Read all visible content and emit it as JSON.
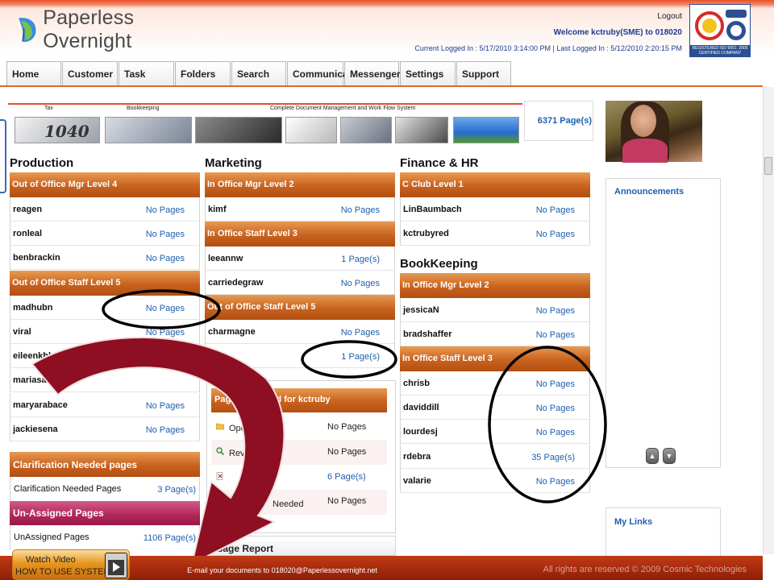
{
  "header": {
    "logo_text": "Paperless Overnight",
    "logout": "Logout",
    "welcome": "Welcome kctruby(SME) to 018020",
    "login_info": "Current Logged In : 5/17/2010 3:14:00 PM  |  Last Logged In : 5/12/2010 2:20:15 PM",
    "cert_text": "REGISTERED ISO 9001: 2000 CERTIFIED COMPANY"
  },
  "nav": [
    {
      "label": "Home"
    },
    {
      "label": "Customer"
    },
    {
      "label": "Task"
    },
    {
      "label": "Folders"
    },
    {
      "label": "Search"
    },
    {
      "label": "Communicate"
    },
    {
      "label": "Messenger"
    },
    {
      "label": "Settings"
    },
    {
      "label": "Support"
    }
  ],
  "banner": {
    "labels": [
      "Tax",
      "Bookkeeping",
      "Complete Document Management and Work Flow System"
    ],
    "total_pages": "6371 Page(s)"
  },
  "production": {
    "title": "Production",
    "group1_title": "Out of Office Mgr Level 4",
    "group1": [
      {
        "name": "reagen",
        "value": "No Pages"
      },
      {
        "name": "ronleal",
        "value": "No Pages"
      },
      {
        "name": "benbrackin",
        "value": "No Pages"
      }
    ],
    "group2_title": "Out of Office Staff Level 5",
    "group2": [
      {
        "name": "madhubn",
        "value": "No Pages"
      },
      {
        "name": "viral",
        "value": "No Pages"
      },
      {
        "name": "eileenkhlair",
        "value": ""
      },
      {
        "name": "mariasantiago",
        "value": ""
      },
      {
        "name": "maryarabace",
        "value": "No Pages"
      },
      {
        "name": "jackiesena",
        "value": "No Pages"
      }
    ]
  },
  "marketing": {
    "title": "Marketing",
    "group1_title": "In Office Mgr Level 2",
    "group1": [
      {
        "name": "kimf",
        "value": "No Pages"
      }
    ],
    "group2_title": "In Office Staff Level 3",
    "group2": [
      {
        "name": "leeannw",
        "value": "1 Page(s)"
      },
      {
        "name": "carriedegraw",
        "value": "No Pages"
      }
    ],
    "group3_title": "Out of Office Staff Level 5",
    "group3": [
      {
        "name": "charmagne",
        "value": "No Pages"
      },
      {
        "name": "",
        "value": "1 Page(s)"
      }
    ]
  },
  "finance": {
    "title": "Finance & HR",
    "group1_title": "C Club Level 1",
    "group1": [
      {
        "name": "LinBaumbach",
        "value": "No Pages"
      },
      {
        "name": "kctrubyred",
        "value": "No Pages"
      }
    ]
  },
  "bookkeeping": {
    "title": "BookKeeping",
    "group1_title": "In Office Mgr Level 2",
    "group1": [
      {
        "name": "jessicaN",
        "value": "No Pages"
      },
      {
        "name": "bradshaffer",
        "value": "No Pages"
      }
    ],
    "group2_title": "In Office Staff Level 3",
    "group2": [
      {
        "name": "chrisb",
        "value": "No Pages"
      },
      {
        "name": "daviddill",
        "value": "No Pages"
      },
      {
        "name": "lourdesj",
        "value": "No Pages"
      },
      {
        "name": "rdebra",
        "value": "35 Page(s)"
      },
      {
        "name": "valarie",
        "value": "No Pages"
      }
    ]
  },
  "pages_assigned": {
    "title": "Pages assigned for kctruby",
    "rows": [
      {
        "label": "Open",
        "value": "No Pages"
      },
      {
        "label": "Revie",
        "value": "No Pages"
      },
      {
        "label": "",
        "value": "6 Page(s)"
      },
      {
        "label": "Needed",
        "value": "No Pages"
      }
    ]
  },
  "usage_report": "Usage Report",
  "clarification": {
    "title": "Clarification Needed pages",
    "row_label": "Clarification Needed Pages",
    "row_value": "3 Page(s)"
  },
  "unassigned": {
    "title": "Un-Assigned Pages",
    "row_label": "UnAssigned Pages",
    "row_value": "1106 Page(s)"
  },
  "right": {
    "announcements": "Announcements",
    "my_links": "My Links"
  },
  "footer": {
    "watch_top": "Watch Video",
    "watch_bottom": "HOW TO USE SYSTEM",
    "email": "E-mail your  documents to 018020@Paperlessovernight.net",
    "rights": "All rights are reserved © 2009 Cosmic Technologies"
  },
  "colors": {
    "accent_orange": "#c8621e",
    "link_blue": "#1d5fae",
    "unassigned_magenta": "#b22a5a",
    "footer_red": "#a82810",
    "annotation_arrow": "#8e0e22"
  }
}
